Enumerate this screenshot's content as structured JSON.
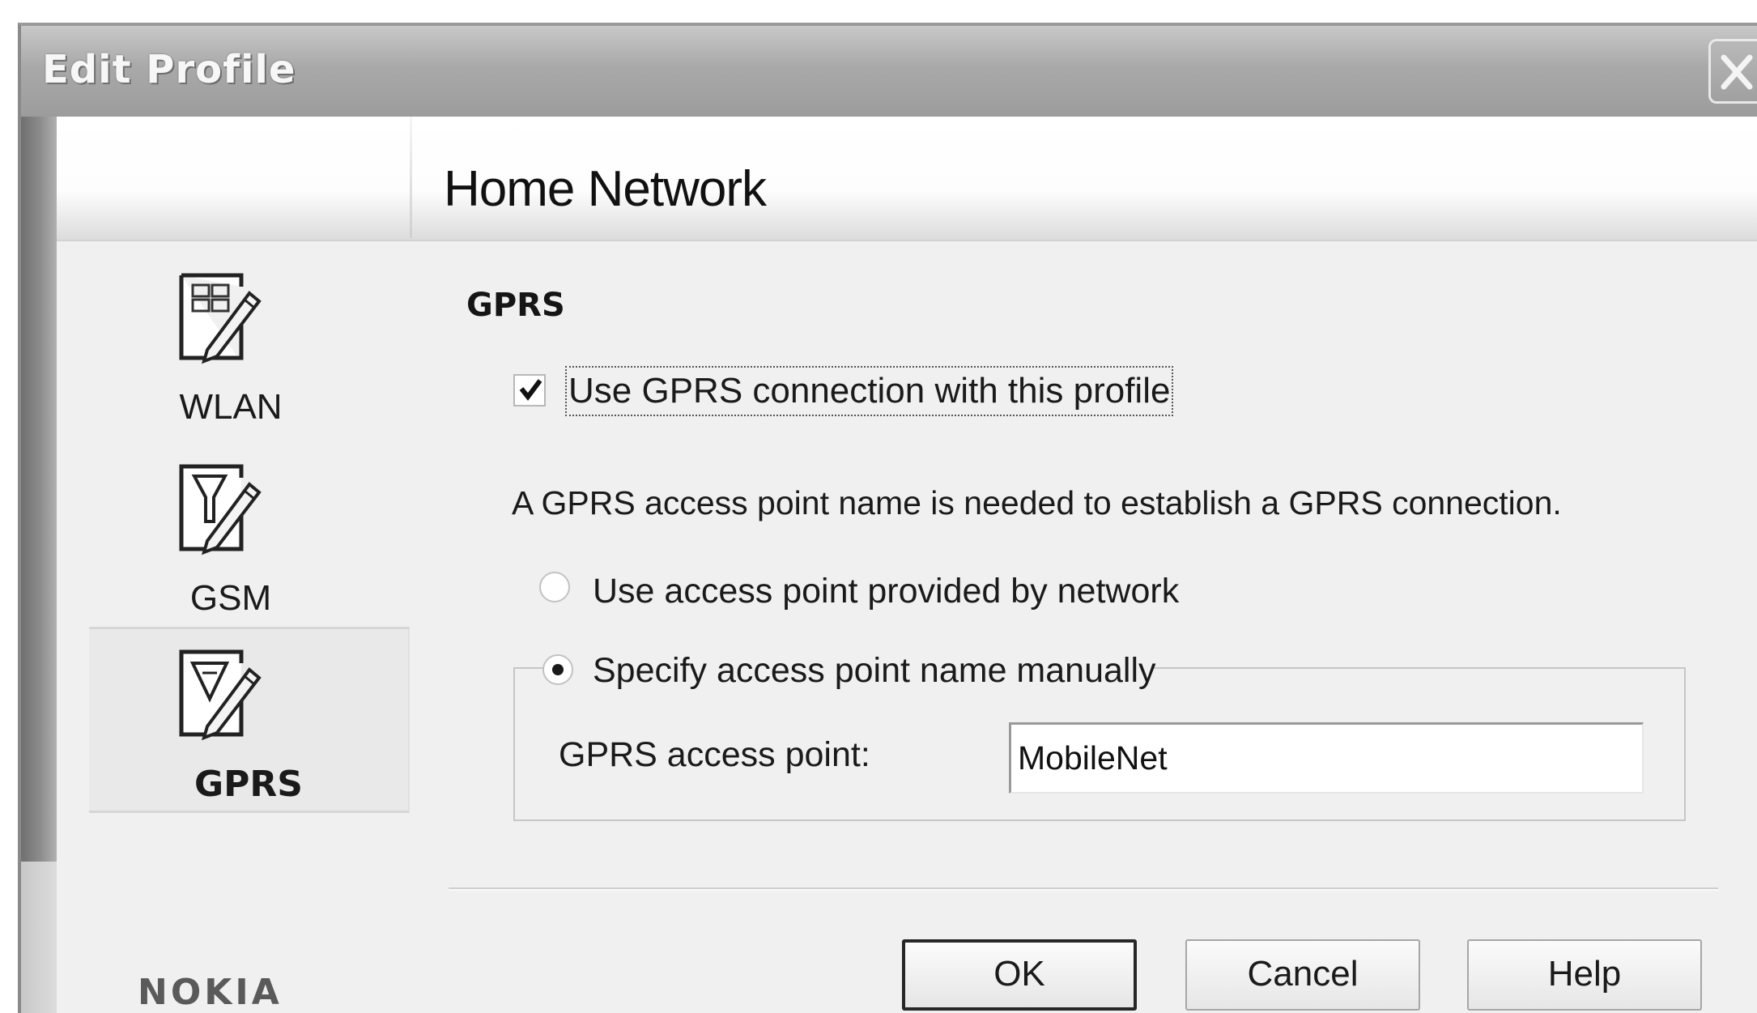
{
  "window": {
    "title": "Edit Profile"
  },
  "header": {
    "title": "Home Network"
  },
  "sidebar": {
    "items": [
      {
        "label": "WLAN",
        "icon": "wlan-settings-icon",
        "selected": false
      },
      {
        "label": "GSM",
        "icon": "gsm-settings-icon",
        "selected": false
      },
      {
        "label": "GPRS",
        "icon": "gprs-settings-icon",
        "selected": true
      }
    ],
    "brand": "NOKIA"
  },
  "main": {
    "section_title": "GPRS",
    "use_gprs": {
      "label": "Use GPRS connection with this profile",
      "checked": true
    },
    "info": "A GPRS access point name is needed to establish a GPRS connection.",
    "radio_network": {
      "label": "Use access point provided by network",
      "selected": false
    },
    "radio_manual": {
      "label": "Specify access point name manually",
      "selected": true
    },
    "access_point": {
      "label": "GPRS access point:",
      "value": "MobileNet"
    }
  },
  "buttons": {
    "ok": "OK",
    "cancel": "Cancel",
    "help": "Help"
  }
}
